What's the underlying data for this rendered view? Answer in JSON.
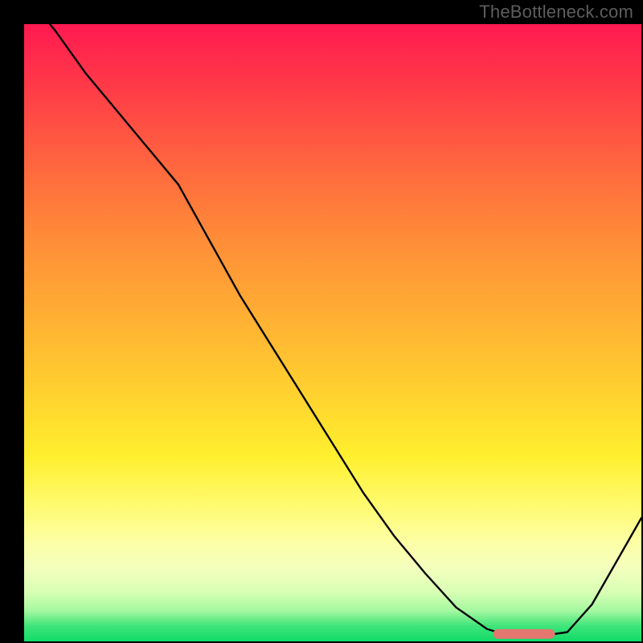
{
  "watermark": "TheBottleneck.com",
  "colors": {
    "background": "#000000",
    "curve": "#000000",
    "marker": "#e3776f",
    "gradient_top": "#ff1a50",
    "gradient_bottom": "#10db68"
  },
  "chart_data": {
    "type": "line",
    "title": "",
    "xlabel": "",
    "ylabel": "",
    "xlim": [
      0,
      100
    ],
    "ylim": [
      0,
      100
    ],
    "x": [
      0,
      5,
      10,
      15,
      20,
      25,
      30,
      35,
      40,
      45,
      50,
      55,
      60,
      65,
      70,
      75,
      79,
      83,
      88,
      92,
      96,
      100
    ],
    "values": [
      105,
      99,
      92,
      86,
      80,
      74,
      65,
      56,
      48,
      40,
      32,
      24,
      17,
      11,
      5.5,
      2,
      0.8,
      0.8,
      1.5,
      6,
      13,
      20
    ],
    "annotations": [
      {
        "kind": "floor-marker",
        "x_start": 76,
        "x_end": 86,
        "y": 1.2
      }
    ]
  }
}
